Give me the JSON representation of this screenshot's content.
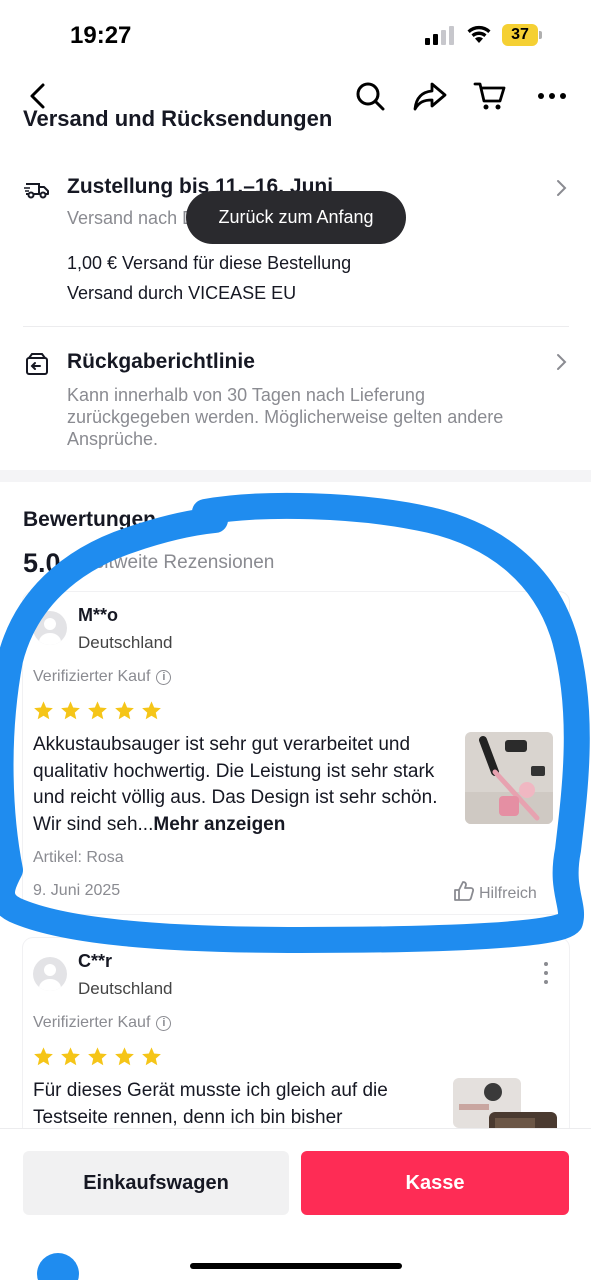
{
  "status_bar": {
    "time": "19:27",
    "battery": "37"
  },
  "nav": {
    "icons": [
      "back-icon",
      "search-icon",
      "share-icon",
      "cart-icon",
      "more-icon"
    ]
  },
  "shipping": {
    "section_heading": "Versand und Rücksendungen",
    "delivery_title": "Zustellung bis 11.–16. Juni",
    "delivery_sub": "Versand nach Deutschland",
    "shipping_cost": "1,00 € Versand für diese Bestellung",
    "shipped_by": "Versand durch VICEASE EU",
    "return_title": "Rückgaberichtlinie",
    "return_sub": "Kann innerhalb von 30 Tagen nach Lieferung zurückgegeben werden. Möglicherweise gelten andere Ansprüche."
  },
  "toast": {
    "label": "Zurück zum Anfang"
  },
  "reviews": {
    "title": "Bewertungen",
    "rating": "5.0",
    "count_label": "weltweite Rezensionen",
    "items": [
      {
        "name": "M**o",
        "country": "Deutschland",
        "verified": "Verifizierter Kauf",
        "stars": 5,
        "text": "Akkustaubsauger ist sehr gut verarbeitet und qualitativ hochwertig. Die Leistung ist sehr stark und reicht völlig aus. Das Design ist sehr schön. Wir sind seh...",
        "more": "Mehr anzeigen",
        "item": "Artikel: Rosa",
        "date": "9. Juni 2025",
        "helpful": "Hilfreich"
      },
      {
        "name": "C**r",
        "country": "Deutschland",
        "verified": "Verifizierter Kauf",
        "stars": 5,
        "text": "Für dieses Gerät musste ich gleich auf die Testseite rennen, denn ich bin bisher"
      }
    ]
  },
  "bottom_bar": {
    "cart_label": "Einkaufswagen",
    "checkout_label": "Kasse"
  },
  "colors": {
    "accent": "#fe2c55",
    "annotation": "#1f8cef",
    "star": "#f5c518"
  }
}
